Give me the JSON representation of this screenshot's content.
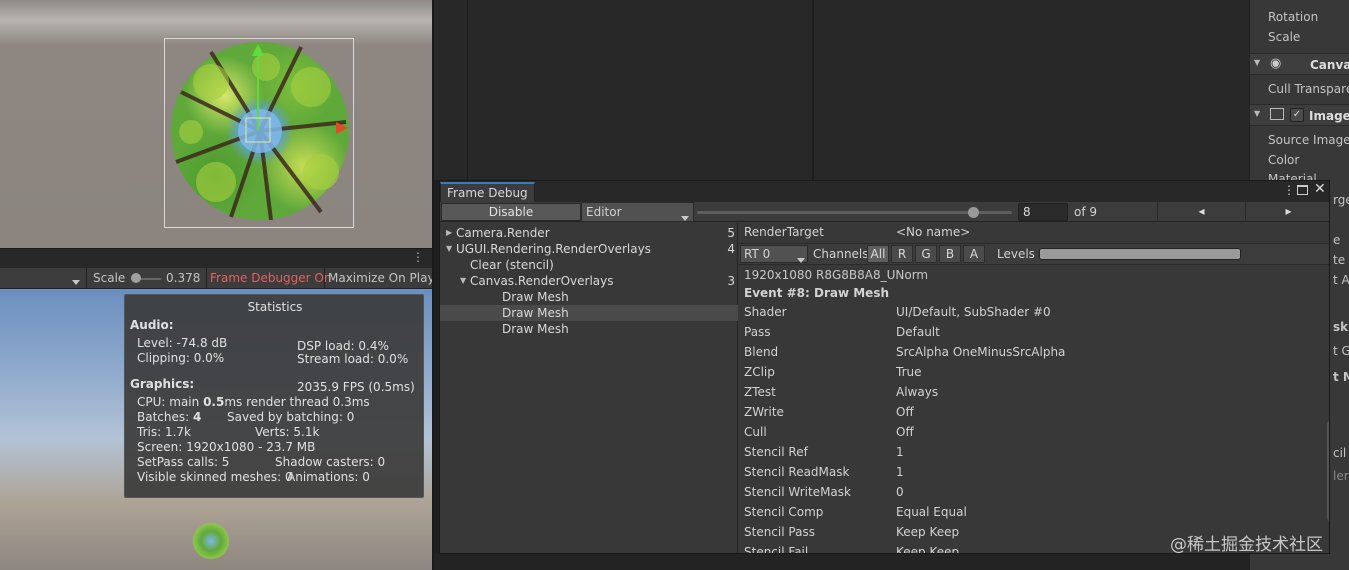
{
  "scene": {
    "gizmo_colors": {
      "y_axis": "#5fdc3a",
      "x_axis": "#e34a2a",
      "rect": "#d8d8d8"
    }
  },
  "game_toolbar": {
    "scale_label": "Scale",
    "scale_value": "0.378",
    "frame_debugger_label": "Frame Debugger On",
    "frame_debugger_color": "#e06262",
    "maximize_label": "Maximize On Play"
  },
  "stats": {
    "title": "Statistics",
    "audio_header": "Audio:",
    "level": "Level: -74.8 dB",
    "clipping": "Clipping: 0.0%",
    "dsp_load": "DSP load: 0.4%",
    "stream_load": "Stream load: 0.0%",
    "graphics_header": "Graphics:",
    "fps": "2035.9 FPS (0.5ms)",
    "cpu_prefix": "CPU: main ",
    "cpu_main": "0.5",
    "cpu_suffix": "ms  render thread 0.3ms",
    "batches_prefix": "Batches: ",
    "batches_value": "4",
    "saved_by_batching": "Saved by batching: 0",
    "tris": "Tris: 1.7k",
    "verts": "Verts: 5.1k",
    "screen": "Screen: 1920x1080 - 23.7 MB",
    "setpass": "SetPass calls: 5",
    "shadow_casters": "Shadow casters: 0",
    "skinned_meshes": "Visible skinned meshes: 0",
    "animations": "Animations: 0"
  },
  "inspector": {
    "rotation": "Rotation",
    "scale": "Scale",
    "canvas_header": "Canvas",
    "cull_transparent": "Cull Transpare",
    "image_header": "Image",
    "source_image": "Source Image",
    "color": "Color",
    "material": "Material",
    "frag1": "rge",
    "frag2": "e",
    "frag3": "te M",
    "frag4": "t As",
    "frag5": "sk",
    "frag6": "t Gr",
    "frag7": "t M",
    "frag8": "cil",
    "frag9": "ler"
  },
  "frame_debug": {
    "tab_title": "Frame Debug",
    "disable_button": "Disable",
    "target_dropdown": "Editor",
    "frame_value": "8",
    "frame_total": "of 9",
    "progress": 0.875,
    "prev_icon": "◂",
    "next_icon": "▸",
    "tree": [
      {
        "label": "Camera.Render",
        "count": "5",
        "indent": 0,
        "arrow": "right",
        "selected": false
      },
      {
        "label": "UGUI.Rendering.RenderOverlays",
        "count": "4",
        "indent": 0,
        "arrow": "down",
        "selected": false
      },
      {
        "label": "Clear (stencil)",
        "count": "",
        "indent": 1,
        "arrow": "",
        "selected": false
      },
      {
        "label": "Canvas.RenderOverlays",
        "count": "3",
        "indent": 1,
        "arrow": "down",
        "selected": false
      },
      {
        "label": "Draw Mesh",
        "count": "",
        "indent": 2,
        "arrow": "",
        "selected": false
      },
      {
        "label": "Draw Mesh",
        "count": "",
        "indent": 2,
        "arrow": "",
        "selected": true
      },
      {
        "label": "Draw Mesh",
        "count": "",
        "indent": 2,
        "arrow": "",
        "selected": false
      }
    ],
    "render_target_label": "RenderTarget",
    "render_target_value": "<No name>",
    "rt_dropdown": "RT 0",
    "channels_label": "Channels",
    "channels": [
      "All",
      "R",
      "G",
      "B",
      "A"
    ],
    "levels_label": "Levels",
    "format": "1920x1080 R8G8B8A8_UNorm",
    "event_title": "Event #8: Draw Mesh",
    "properties": [
      {
        "key": "Shader",
        "value": "UI/Default, SubShader #0"
      },
      {
        "key": "Pass",
        "value": "Default"
      },
      {
        "key": "Blend",
        "value": "SrcAlpha OneMinusSrcAlpha"
      },
      {
        "key": "ZClip",
        "value": "True"
      },
      {
        "key": "ZTest",
        "value": "Always"
      },
      {
        "key": "ZWrite",
        "value": "Off"
      },
      {
        "key": "Cull",
        "value": "Off"
      },
      {
        "key": "Stencil Ref",
        "value": "1"
      },
      {
        "key": "Stencil ReadMask",
        "value": "1"
      },
      {
        "key": "Stencil WriteMask",
        "value": "0"
      },
      {
        "key": "Stencil Comp",
        "value": "Equal Equal"
      },
      {
        "key": "Stencil Pass",
        "value": "Keep Keep"
      },
      {
        "key": "Stencil Fail",
        "value": "Keep Keep"
      }
    ]
  },
  "watermark": "@稀土掘金技术社区"
}
